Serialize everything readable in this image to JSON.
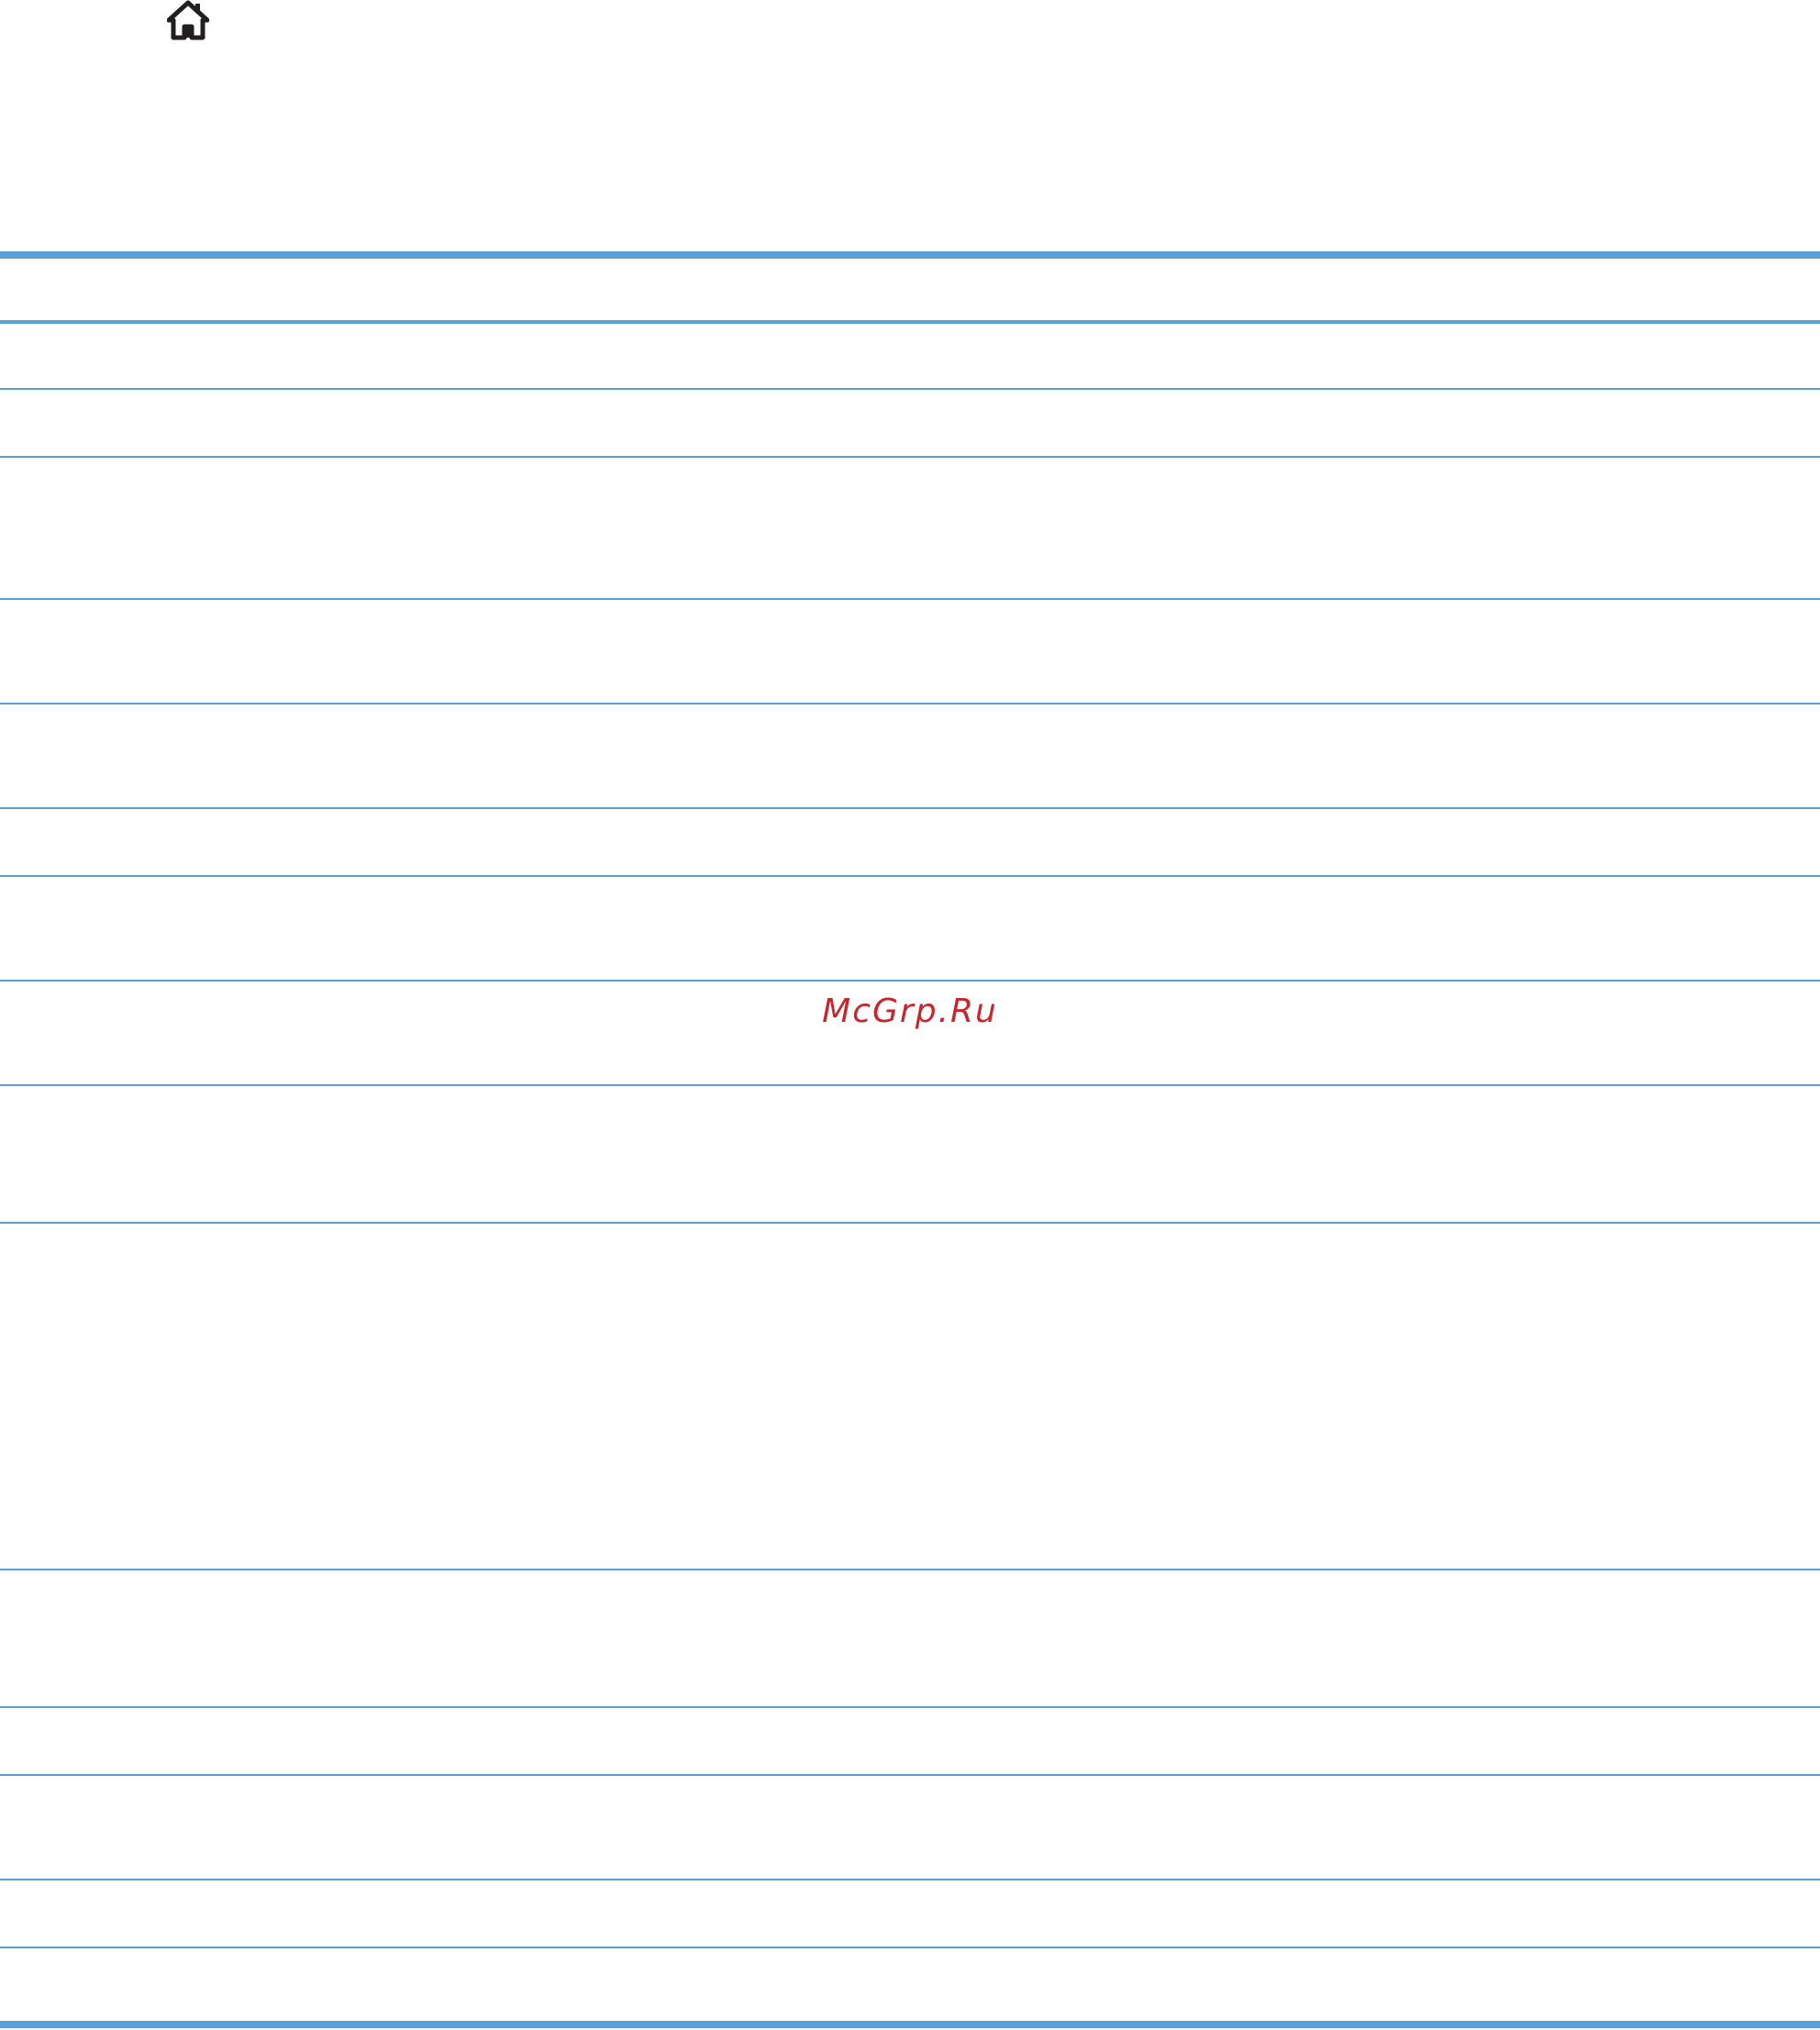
{
  "header": {
    "home_icon": "home-icon"
  },
  "watermark": {
    "text": "McGrp.Ru"
  },
  "colors": {
    "rule": "#5aa0d6",
    "watermark": "#c8262c",
    "icon": "#231f20"
  }
}
